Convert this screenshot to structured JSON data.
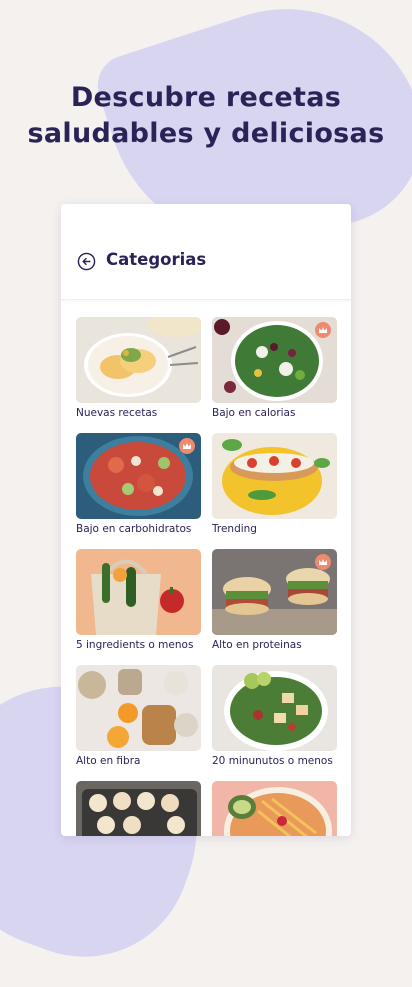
{
  "headline": {
    "line1": "Descubre recetas",
    "line2": "saludables y deliciosas"
  },
  "header": {
    "title": "Categorias",
    "back_icon": "back-arrow-circle-icon"
  },
  "categories": [
    {
      "label": "Nuevas recetas",
      "premium": false
    },
    {
      "label": "Bajo en calorias",
      "premium": true
    },
    {
      "label": "Bajo en carbohidratos",
      "premium": true
    },
    {
      "label": "Trending",
      "premium": false
    },
    {
      "label": "5 ingredients o menos",
      "premium": false
    },
    {
      "label": "Alto en proteinas",
      "premium": true
    },
    {
      "label": "Alto en fibra",
      "premium": false
    },
    {
      "label": "20 minunutos o menos",
      "premium": false
    },
    {
      "label": "",
      "premium": false
    },
    {
      "label": "",
      "premium": false
    }
  ],
  "colors": {
    "background": "#f4f1ee",
    "blob": "#d8d5f1",
    "text": "#2a2358",
    "premium_badge": "#f08a6e"
  }
}
